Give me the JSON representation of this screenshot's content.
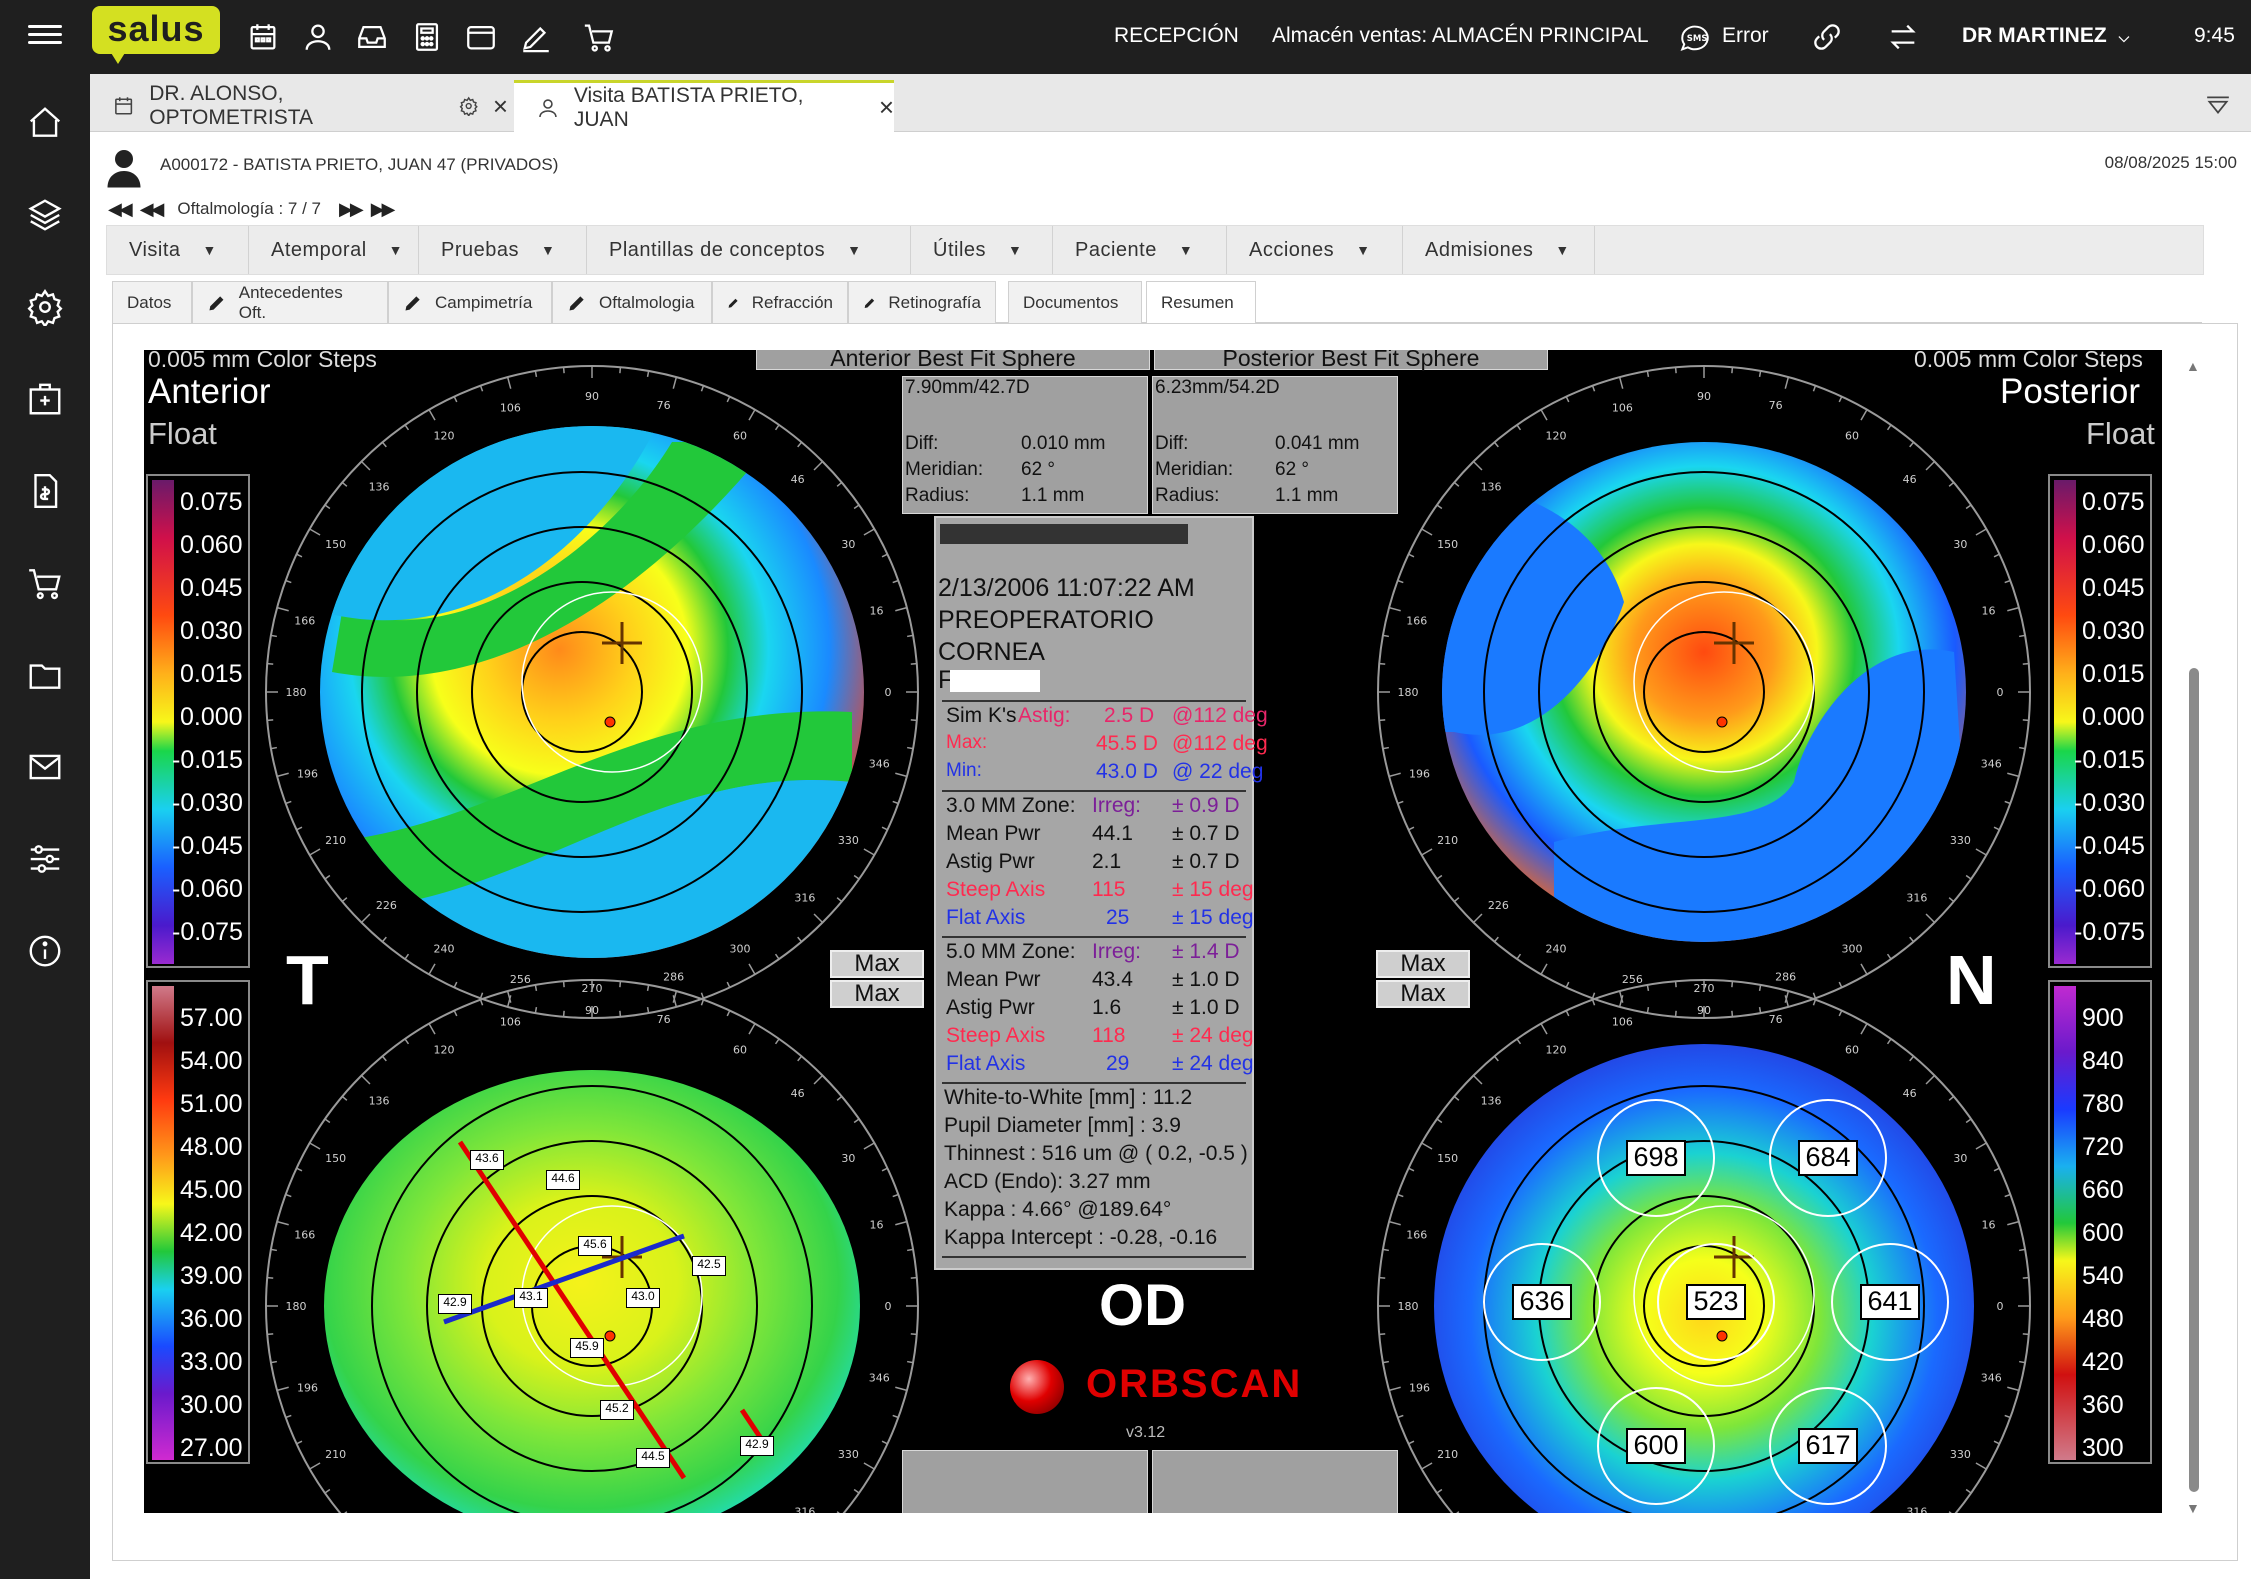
{
  "app": {
    "logo_text": "salus",
    "reception": "RECEPCIÓN",
    "warehouse": "Almacén ventas: ALMACÉN PRINCIPAL",
    "sms_label": "Error",
    "user": "DR MARTINEZ",
    "clock": "9:45",
    "brand_color": "#d4e021"
  },
  "tabs": [
    {
      "label": "DR. ALONSO, OPTOMETRISTA",
      "active": false
    },
    {
      "label": "Visita BATISTA PRIETO, JUAN",
      "active": true
    }
  ],
  "patient": {
    "line": "A000172 - BATISTA PRIETO, JUAN 47 (PRIVADOS)",
    "datetime": "08/08/2025 15:00",
    "record_label": "Oftalmología : 7 / 7"
  },
  "menu": [
    "Visita",
    "Atemporal",
    "Pruebas",
    "Plantillas de conceptos",
    "Útiles",
    "Paciente",
    "Acciones",
    "Admisiones"
  ],
  "subtabs": [
    {
      "label": "Datos",
      "pen": false
    },
    {
      "label": "Antecedentes Oft.",
      "pen": true
    },
    {
      "label": "Campimetría",
      "pen": true
    },
    {
      "label": "Oftalmologia",
      "pen": true
    },
    {
      "label": "Refracción",
      "pen": true
    },
    {
      "label": "Retinografía",
      "pen": true
    },
    {
      "label": "Documentos",
      "pen": false
    },
    {
      "label": "Resumen",
      "pen": false,
      "active": true
    }
  ],
  "orbscan": {
    "color_steps_left": "0.005 mm Color Steps",
    "color_steps_right": "0.005 mm Color Steps",
    "anterior_title": "Anterior",
    "anterior_sub": "Float",
    "posterior_title": "Posterior",
    "posterior_sub": "Float",
    "anterior_bfs_title": "Anterior Best Fit Sphere",
    "posterior_bfs_title": "Posterior Best Fit Sphere",
    "anterior_bfs": {
      "value": "7.90mm/42.7D",
      "diff_label": "Diff:",
      "diff": "0.010 mm",
      "meridian_label": "Meridian:",
      "meridian": "62 °",
      "radius_label": "Radius:",
      "radius": "1.1 mm"
    },
    "posterior_bfs": {
      "value": "6.23mm/54.2D",
      "diff_label": "Diff:",
      "diff": "0.041 mm",
      "meridian_label": "Meridian:",
      "meridian": "62 °",
      "radius_label": "Radius:",
      "radius": "1.1 mm"
    },
    "exam_date": "2/13/2006 11:07:22 AM",
    "exam_type": "PREOPERATORIO",
    "exam_site": "CORNEA",
    "exam_patient_initial": "F",
    "sim_k_label": "Sim K's",
    "sim_k_astig_label": "Astig:",
    "sim_k_astig": "2.5 D",
    "sim_k_astig_axis": "@112 deg",
    "sim_k_max_label": "Max:",
    "sim_k_max": "45.5 D",
    "sim_k_max_axis": "@112 deg",
    "sim_k_min_label": "Min:",
    "sim_k_min": "43.0 D",
    "sim_k_min_axis": "@ 22 deg",
    "zone3": {
      "title": "3.0 MM Zone:",
      "irreg_label": "Irreg:",
      "irreg": "± 0.9 D",
      "mean_label": "Mean Pwr",
      "mean": "44.1",
      "mean_err": "± 0.7 D",
      "astig_label": "Astig Pwr",
      "astig": "2.1",
      "astig_err": "± 0.7 D",
      "steep_label": "Steep Axis",
      "steep": "115",
      "steep_err": "± 15 deg",
      "flat_label": "Flat Axis",
      "flat": "25",
      "flat_err": "± 15 deg"
    },
    "zone5": {
      "title": "5.0 MM Zone:",
      "irreg_label": "Irreg:",
      "irreg": "± 1.4 D",
      "mean_label": "Mean Pwr",
      "mean": "43.4",
      "mean_err": "± 1.0 D",
      "astig_label": "Astig Pwr",
      "astig": "1.6",
      "astig_err": "± 1.0 D",
      "steep_label": "Steep Axis",
      "steep": "118",
      "steep_err": "± 24 deg",
      "flat_label": "Flat Axis",
      "flat": "29",
      "flat_err": "± 24 deg"
    },
    "wtw": "White-to-White [mm] : 11.2",
    "pupil": "Pupil Diameter [mm] :  3.9",
    "thinnest": "Thinnest : 516 um @ ( 0.2, -0.5 )",
    "acd": "ACD (Endo): 3.27 mm",
    "kappa": "Kappa : 4.66° @189.64°",
    "kappa_intercept": "Kappa Intercept : -0.28, -0.16",
    "eye": "OD",
    "brand": "ORBSCAN",
    "version": "v3.12",
    "max_button": "Max",
    "left_letter": "T",
    "right_letter": "N",
    "float_scale": [
      "0.075",
      "0.060",
      "0.045",
      "0.030",
      "0.015",
      "0.000",
      "-0.015",
      "-0.030",
      "-0.045",
      "-0.060",
      "-0.075"
    ],
    "keratometric_scale": [
      "57.00",
      "54.00",
      "51.00",
      "48.00",
      "45.00",
      "42.00",
      "39.00",
      "36.00",
      "33.00",
      "30.00",
      "27.00"
    ],
    "pachymetry_scale": [
      "900",
      "840",
      "780",
      "720",
      "660",
      "600",
      "540",
      "480",
      "420",
      "360",
      "300"
    ],
    "pachymetry_values": {
      "top_left": "698",
      "top_right": "684",
      "left": "636",
      "center": "523",
      "right": "641",
      "bottom_left": "600",
      "bottom_right": "617"
    },
    "kmap_values": [
      "43.6",
      "44.6",
      "45.6",
      "42.5",
      "42.9",
      "43.1",
      "43.0",
      "45.9",
      "45.2",
      "44.5",
      "42.9"
    ],
    "ring_labels": [
      "106",
      "90",
      "76",
      "120",
      "60",
      "136",
      "46",
      "150",
      "30",
      "166",
      "16",
      "180",
      "0",
      "196",
      "346",
      "210",
      "330",
      "226",
      "316",
      "240",
      "300",
      "256",
      "270",
      "286"
    ]
  }
}
